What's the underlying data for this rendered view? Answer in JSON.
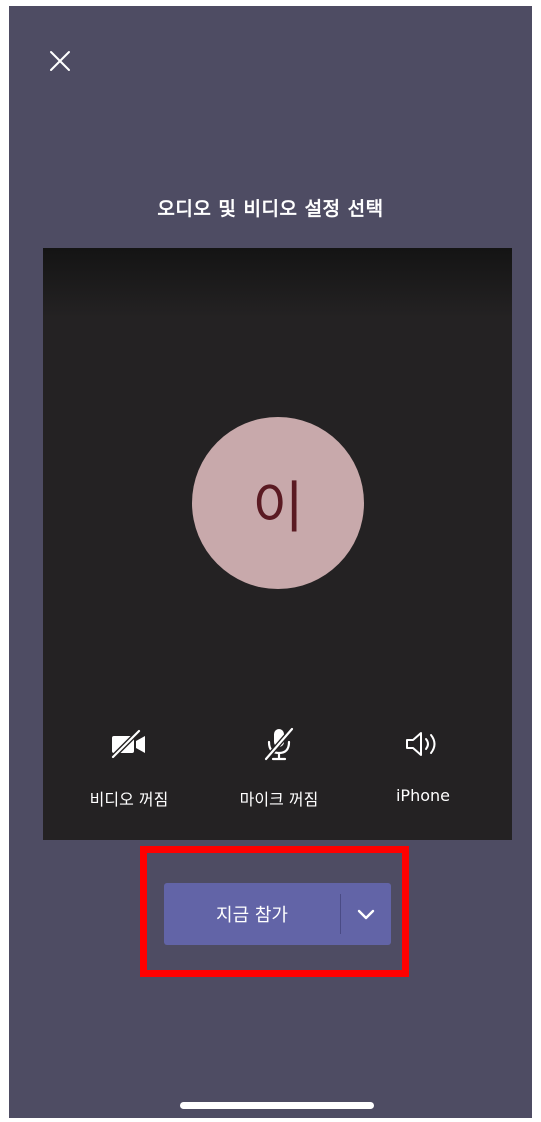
{
  "header": {
    "close_icon": "close-icon",
    "title": "오디오 및 비디오 설정 선택"
  },
  "preview": {
    "avatar_initial": "이",
    "avatar_color": "#c8a9ab",
    "avatar_text_color": "#5a1a22"
  },
  "controls": [
    {
      "icon": "video-off-icon",
      "label": "비디오 꺼짐"
    },
    {
      "icon": "mic-off-icon",
      "label": "마이크 꺼짐"
    },
    {
      "icon": "speaker-icon",
      "label": "iPhone"
    }
  ],
  "join": {
    "label": "지금 참가",
    "dropdown_icon": "chevron-down-icon",
    "button_color": "#6264a7"
  },
  "highlight_color": "#ff0000",
  "background_color": "#4e4c63"
}
